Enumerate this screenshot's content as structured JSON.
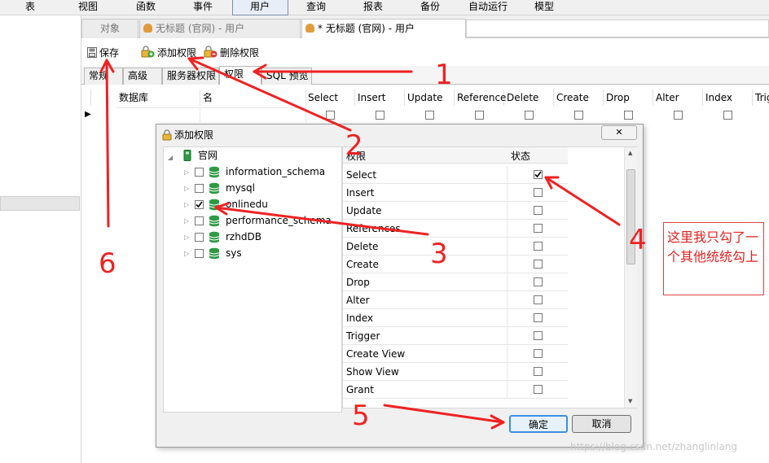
{
  "menubar": {
    "items": [
      "表",
      "视图",
      "函数",
      "事件",
      "用户",
      "查询",
      "报表",
      "备份",
      "自动运行",
      "模型"
    ],
    "active_index": 4
  },
  "doc_tabs": [
    "对象",
    "无标题 (官网) - 用户",
    "* 无标题 (官网) - 用户"
  ],
  "toolbar": {
    "save": "保存",
    "add_priv": "添加权限",
    "del_priv": "删除权限"
  },
  "sub_tabs": [
    "常规",
    "高级",
    "服务器权限",
    "权限",
    "SQL 预览"
  ],
  "grid_headers": [
    "数据库",
    "名",
    "Select",
    "Insert",
    "Update",
    "Reference",
    "Delete",
    "Create",
    "Drop",
    "Alter",
    "Index",
    "Trig"
  ],
  "dialog": {
    "title": "添加权限",
    "tree_root": "官网",
    "databases": [
      {
        "name": "information_schema",
        "checked": false
      },
      {
        "name": "mysql",
        "checked": false
      },
      {
        "name": "onlinedu",
        "checked": true
      },
      {
        "name": "performance_schema",
        "checked": false
      },
      {
        "name": "rzhdDB",
        "checked": false
      },
      {
        "name": "sys",
        "checked": false
      }
    ],
    "col_priv": "权限",
    "col_status": "状态",
    "privileges": [
      {
        "name": "Select",
        "checked": true
      },
      {
        "name": "Insert",
        "checked": false
      },
      {
        "name": "Update",
        "checked": false
      },
      {
        "name": "References",
        "checked": false
      },
      {
        "name": "Delete",
        "checked": false
      },
      {
        "name": "Create",
        "checked": false
      },
      {
        "name": "Drop",
        "checked": false
      },
      {
        "name": "Alter",
        "checked": false
      },
      {
        "name": "Index",
        "checked": false
      },
      {
        "name": "Trigger",
        "checked": false
      },
      {
        "name": "Create View",
        "checked": false
      },
      {
        "name": "Show View",
        "checked": false
      },
      {
        "name": "Grant",
        "checked": false
      }
    ],
    "ok": "确定",
    "cancel": "取消"
  },
  "annotation": {
    "note": "这里我只勾了一个其他统统勾上",
    "step_labels": [
      "1",
      "2",
      "3",
      "4",
      "5",
      "6"
    ],
    "color": "#e42020"
  },
  "watermark": "https://blog.csdn.net/zhanglinlang"
}
